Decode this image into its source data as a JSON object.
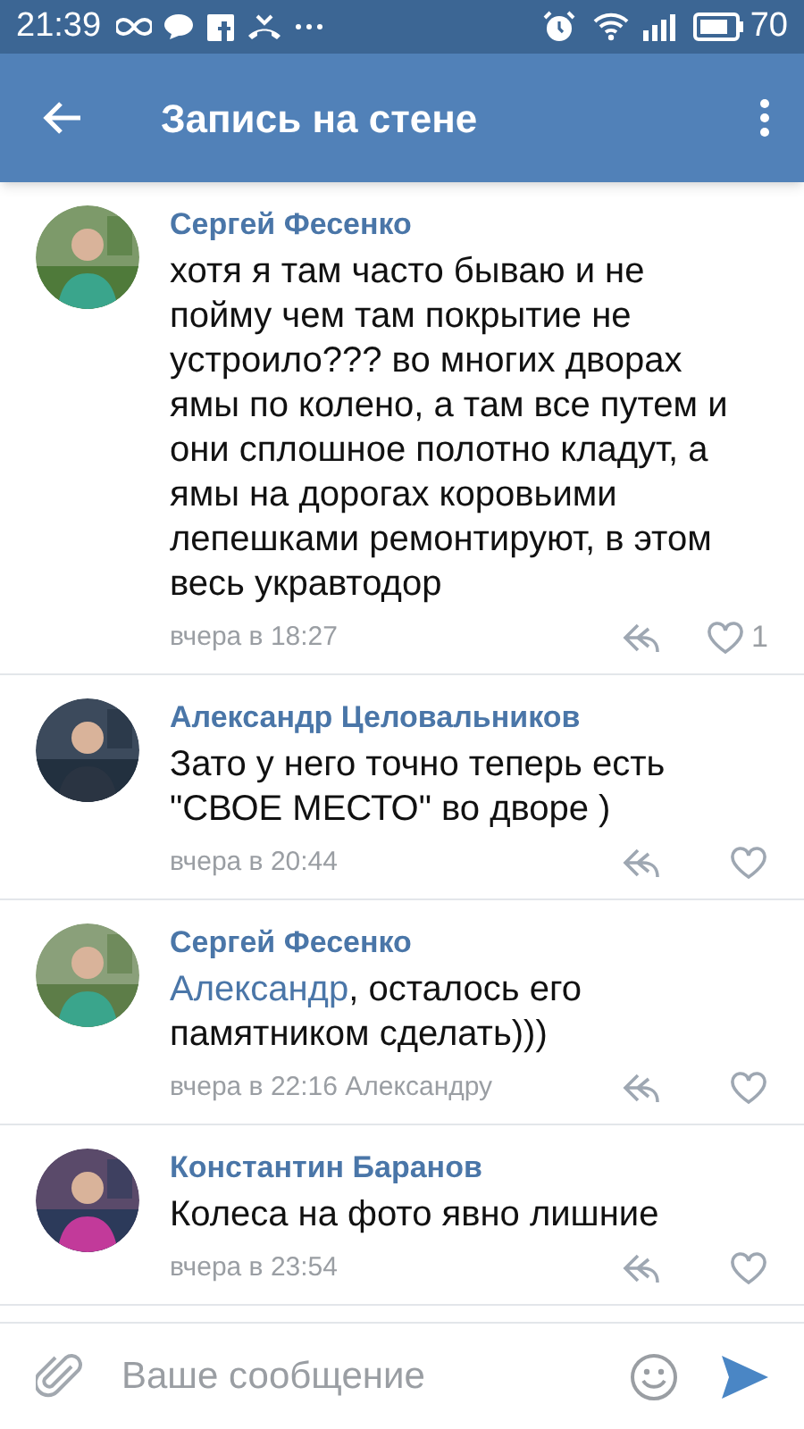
{
  "status_bar": {
    "time": "21:39",
    "battery": "70"
  },
  "app_bar": {
    "title": "Запись на стене"
  },
  "comments": [
    {
      "author": "Сергей Фесенко",
      "text": "хотя я там часто бываю и не пойму чем там покрытие не устроило??? во многих дворах ямы по колено, а там все путем и они сплошное полотно кладут, а ямы на дорогах коровьими лепешками ремонтируют, в этом весь укравтодор",
      "meta": "вчера в 18:27",
      "likes": "1"
    },
    {
      "author": "Александр Целовальников",
      "text": "Зато у него точно теперь есть \"СВОЕ МЕСТО\" во дворе )",
      "meta": "вчера в 20:44"
    },
    {
      "author": "Сергей Фесенко",
      "reply_to": "Александр",
      "text": ", осталось его памятником сделать)))",
      "meta": "вчера в 22:16 Александру"
    },
    {
      "author": "Константин Баранов",
      "text": "Колеса на фото явно лишние",
      "meta": "вчера в 23:54"
    }
  ],
  "composer": {
    "placeholder": "Ваше сообщение"
  }
}
